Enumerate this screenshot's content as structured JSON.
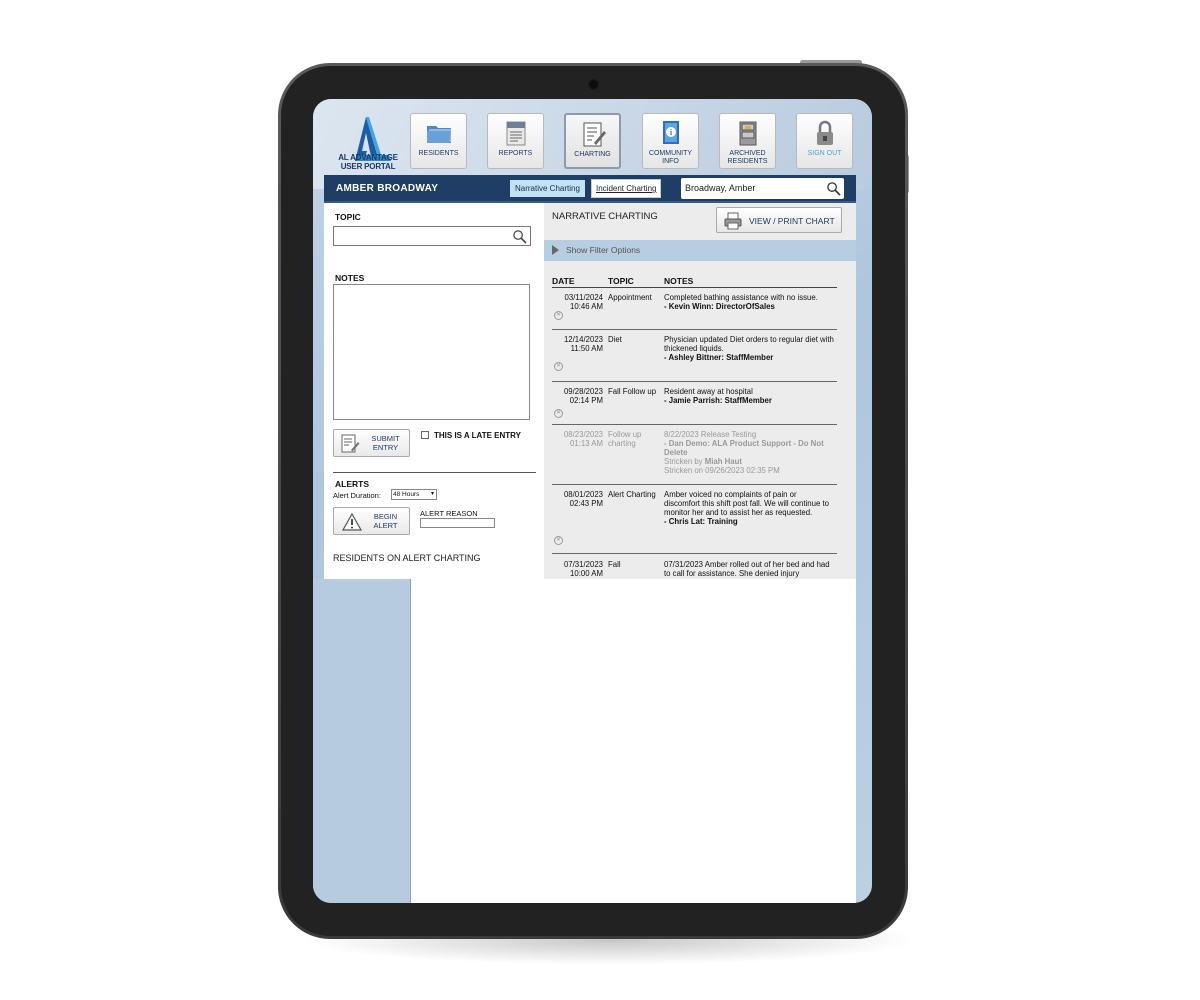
{
  "nav": {
    "logo": {
      "line1": "AL ADVANTAGE",
      "line2": "USER PORTAL"
    },
    "items": [
      {
        "label": "RESIDENTS",
        "icon": "folder-icon"
      },
      {
        "label": "REPORTS",
        "icon": "report-icon"
      },
      {
        "label": "CHARTING",
        "icon": "clipboard-icon",
        "active": true
      },
      {
        "label": "COMMUNITY INFO",
        "icon": "info-book-icon"
      },
      {
        "label": "ARCHIVED RESIDENTS",
        "icon": "cabinet-icon"
      },
      {
        "label": "SIGN OUT",
        "icon": "lock-icon"
      }
    ]
  },
  "header": {
    "resident_name": "AMBER BROADWAY",
    "tab_narrative": "Narrative Charting",
    "tab_incident": "Incident Charting",
    "resident_search": "Broadway, Amber"
  },
  "form": {
    "topic_label": "TOPIC",
    "notes_label": "NOTES",
    "submit_label": "SUBMIT ENTRY",
    "late_entry_label": "THIS IS A LATE ENTRY",
    "alerts_label": "ALERTS",
    "alert_duration_label": "Alert Duration:",
    "alert_duration_value": "48 Hours",
    "begin_alert_label": "BEGIN ALERT",
    "alert_reason_label": "ALERT REASON",
    "residents_on_alert_label": "RESIDENTS ON ALERT CHARTING"
  },
  "narrative": {
    "title": "NARRATIVE CHARTING",
    "print_label": "VIEW / PRINT CHART",
    "filter_label": "Show Filter Options",
    "columns": [
      "DATE",
      "TOPIC",
      "NOTES"
    ],
    "entries": [
      {
        "date": "03/11/2024",
        "time": "10:46 AM",
        "topic": "Appointment",
        "note": "Completed bathing assistance with no issue.",
        "author": "- Kevin Winn: DirectorOfSales",
        "struck": false
      },
      {
        "date": "12/14/2023",
        "time": "11:50 AM",
        "topic": "Diet",
        "note": "Physician updated Diet orders to regular diet with thickened liquids.",
        "author": "- Ashley Bittner: StaffMember",
        "struck": false
      },
      {
        "date": "09/28/2023",
        "time": "02:14 PM",
        "topic": "Fall Follow up",
        "note": "Resident away at hospital",
        "author": "- Jamie Parrish: StaffMember",
        "struck": false
      },
      {
        "date": "08/23/2023",
        "time": "01:13 AM",
        "topic": "Follow up charting",
        "note": "8/22/2023 Release Testing",
        "author": "- Dan Demo: ALA Product Support - Do Not Delete",
        "stricken_by": "Stricken by",
        "stricken_name": "Miah Haut",
        "stricken_on": "Stricken on 09/26/2023 02:35 PM",
        "struck": true
      },
      {
        "date": "08/01/2023",
        "time": "02:43 PM",
        "topic": "Alert Charting",
        "note": "Amber voiced no complaints of pain or discomfort this shift post fall. We will continue to monitor her and to assist her as requested.",
        "author": "- Chris Lat: Training",
        "struck": false
      },
      {
        "date": "07/31/2023",
        "time": "10:00 AM",
        "topic": "Fall",
        "note": "07/31/2023 Amber rolled out of her bed and had to call for assistance. She denied injury",
        "author": "",
        "struck": false
      }
    ]
  },
  "colors": {
    "header_bg": "#1f3e66",
    "tab_active": "#bfe3f3",
    "filter_bar": "#b7cde2",
    "accent": "#1c3a64"
  }
}
